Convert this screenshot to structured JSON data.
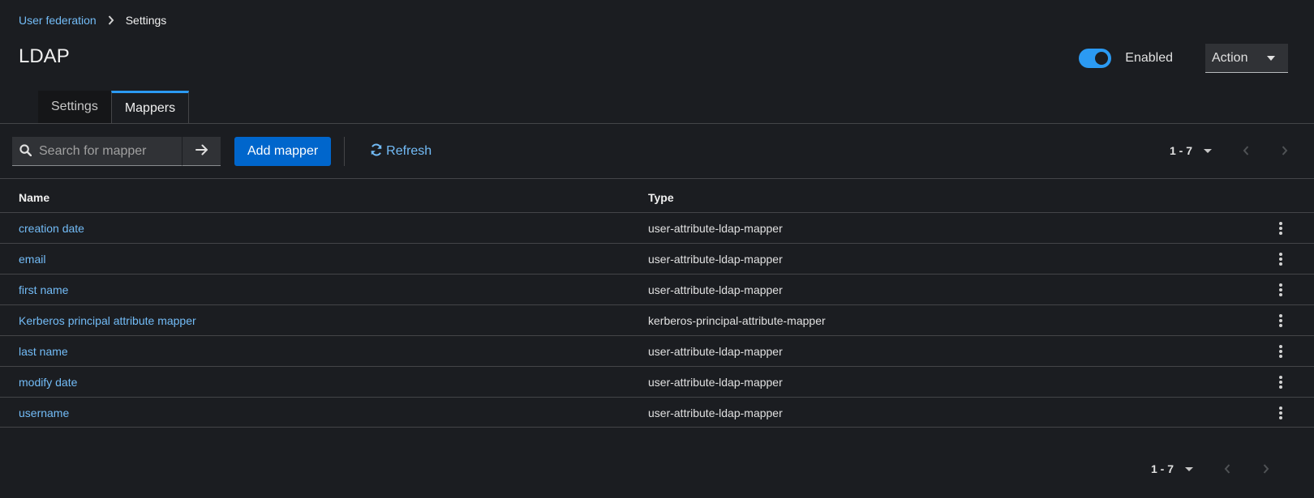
{
  "breadcrumb": {
    "parent": "User federation",
    "current": "Settings"
  },
  "page": {
    "title": "LDAP"
  },
  "header": {
    "enabled_label": "Enabled",
    "enabled": true,
    "action_label": "Action"
  },
  "tabs": [
    {
      "label": "Settings",
      "active": false
    },
    {
      "label": "Mappers",
      "active": true
    }
  ],
  "toolbar": {
    "search_placeholder": "Search for mapper",
    "add_label": "Add mapper",
    "refresh_label": "Refresh"
  },
  "pagination": {
    "range": "1 - 7"
  },
  "table": {
    "columns": [
      "Name",
      "Type"
    ],
    "rows": [
      {
        "name": "creation date",
        "type": "user-attribute-ldap-mapper"
      },
      {
        "name": "email",
        "type": "user-attribute-ldap-mapper"
      },
      {
        "name": "first name",
        "type": "user-attribute-ldap-mapper"
      },
      {
        "name": "Kerberos principal attribute mapper",
        "type": "kerberos-principal-attribute-mapper"
      },
      {
        "name": "last name",
        "type": "user-attribute-ldap-mapper"
      },
      {
        "name": "modify date",
        "type": "user-attribute-ldap-mapper"
      },
      {
        "name": "username",
        "type": "user-attribute-ldap-mapper"
      }
    ]
  },
  "colors": {
    "accent": "#2b9af3",
    "link": "#73bcf7",
    "primary_button": "#0066cc",
    "background": "#1b1d21"
  },
  "icons": [
    "chevron-right-icon",
    "caret-down-icon",
    "search-icon",
    "arrow-right-icon",
    "sync-icon",
    "angle-left-icon",
    "angle-right-icon",
    "kebab-icon"
  ]
}
